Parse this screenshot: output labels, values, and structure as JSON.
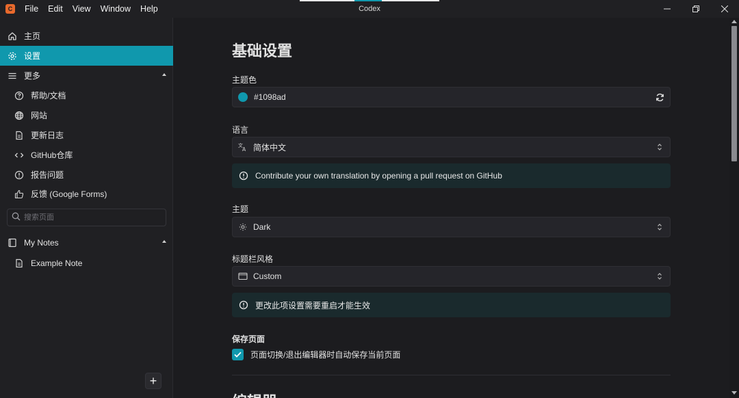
{
  "app": {
    "title": "Codex",
    "menu": [
      "File",
      "Edit",
      "View",
      "Window",
      "Help"
    ],
    "logo_glyph": "C"
  },
  "colors": {
    "accent": "#1098ad",
    "sidebar_bg": "#202023",
    "main_bg": "#1c1c1f",
    "logo": "#e8692c",
    "alert_bg": "#1a2a2d"
  },
  "sidebar": {
    "home": "主页",
    "settings": "设置",
    "more": "更多",
    "more_items": [
      {
        "label": "帮助/文档",
        "icon": "help-circle-icon"
      },
      {
        "label": "网站",
        "icon": "globe-icon"
      },
      {
        "label": "更新日志",
        "icon": "file-text-icon"
      },
      {
        "label": "GitHub仓库",
        "icon": "code-icon"
      },
      {
        "label": "报告问题",
        "icon": "alert-circle-icon"
      },
      {
        "label": "反馈 (Google Forms)",
        "icon": "thumbs-up-icon"
      }
    ],
    "search_placeholder": "搜索页面",
    "notebook": "My Notes",
    "notes": [
      "Example Note"
    ],
    "add_label": "+"
  },
  "settings": {
    "title": "基础设置",
    "theme_color_label": "主题色",
    "theme_color_value": "#1098ad",
    "language_label": "语言",
    "language_value": "简体中文",
    "translation_notice": "Contribute your own translation by opening a pull request on GitHub",
    "theme_label": "主题",
    "theme_value": "Dark",
    "titlebar_label": "标题栏风格",
    "titlebar_value": "Custom",
    "restart_notice": "更改此项设置需要重启才能生效",
    "save_label": "保存页面",
    "autosave_label": "页面切换/退出编辑器时自动保存当前页面",
    "autosave_checked": true,
    "next_section": "编辑器"
  }
}
